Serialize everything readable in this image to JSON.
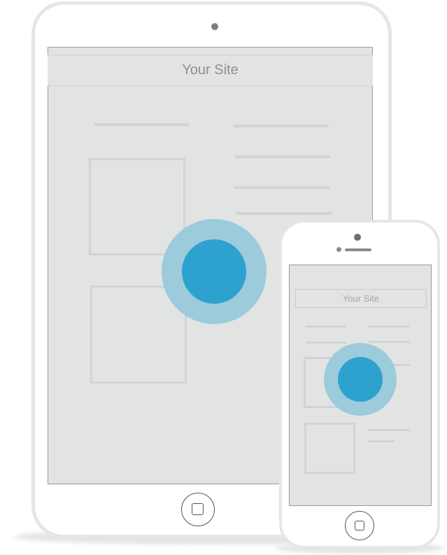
{
  "tablet": {
    "site_title": "Your Site"
  },
  "phone": {
    "site_title": "Your Site"
  },
  "colors": {
    "touch_outer": "#9ccbdc",
    "touch_inner": "#2ea2cf",
    "screen_bg": "#e2e3e3",
    "device_frame": "#e6e6e6",
    "placeholder": "#d2d3d3"
  },
  "icons": {
    "home": "home-button-icon",
    "camera": "camera-icon",
    "touch": "touch-indicator-icon"
  }
}
